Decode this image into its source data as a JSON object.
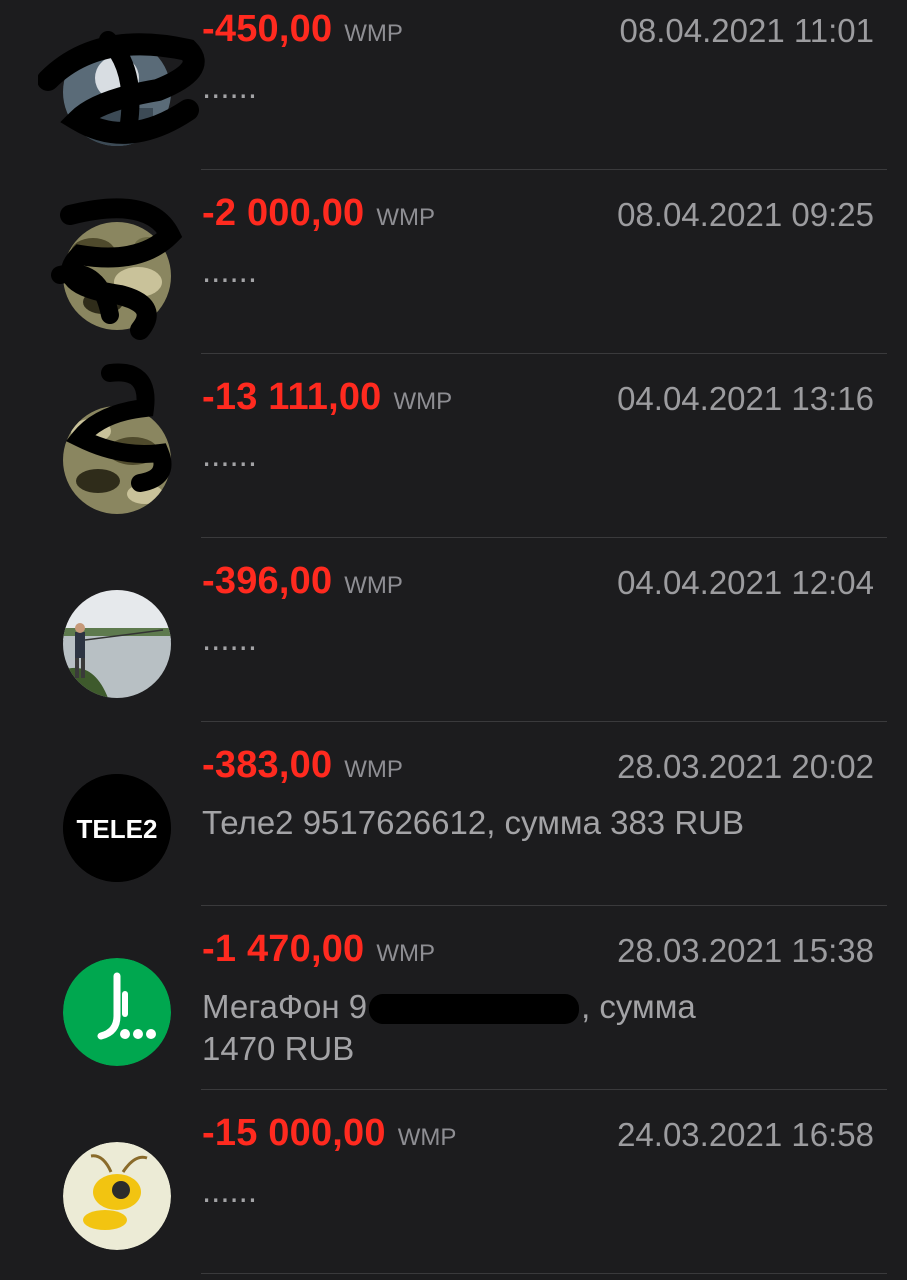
{
  "transactions": [
    {
      "amount": "-450,00",
      "currency": "WMP",
      "datetime": "08.04.2021 11:01",
      "description": "......",
      "avatar_icon": "redacted-photo-avatar"
    },
    {
      "amount": "-2 000,00",
      "currency": "WMP",
      "datetime": "08.04.2021 09:25",
      "description": "......",
      "avatar_icon": "camouflage-avatar"
    },
    {
      "amount": "-13 111,00",
      "currency": "WMP",
      "datetime": "04.04.2021 13:16",
      "description": "......",
      "avatar_icon": "camouflage-avatar"
    },
    {
      "amount": "-396,00",
      "currency": "WMP",
      "datetime": "04.04.2021 12:04",
      "description": "......",
      "avatar_icon": "fishing-photo-avatar"
    },
    {
      "amount": "-383,00",
      "currency": "WMP",
      "datetime": "28.03.2021 20:02",
      "description": "Теле2 9517626612, сумма 383 RUB",
      "avatar_icon": "tele2-logo",
      "avatar_text": "TELE2"
    },
    {
      "amount": "-1 470,00",
      "currency": "WMP",
      "datetime": "28.03.2021 15:38",
      "description_line1": "МегаФон 9",
      "description_line1_end": ", сумма",
      "description_line2": "1470 RUB",
      "avatar_icon": "megafon-logo"
    },
    {
      "amount": "-15 000,00",
      "currency": "WMP",
      "datetime": "24.03.2021 16:58",
      "description": "......",
      "avatar_icon": "webmoney-ant-logo"
    }
  ],
  "colors": {
    "background": "#1c1c1e",
    "amount": "#ff2a1f",
    "currency": "#8e8e93",
    "text": "#a3a3a6",
    "divider": "#3a3a3c"
  }
}
